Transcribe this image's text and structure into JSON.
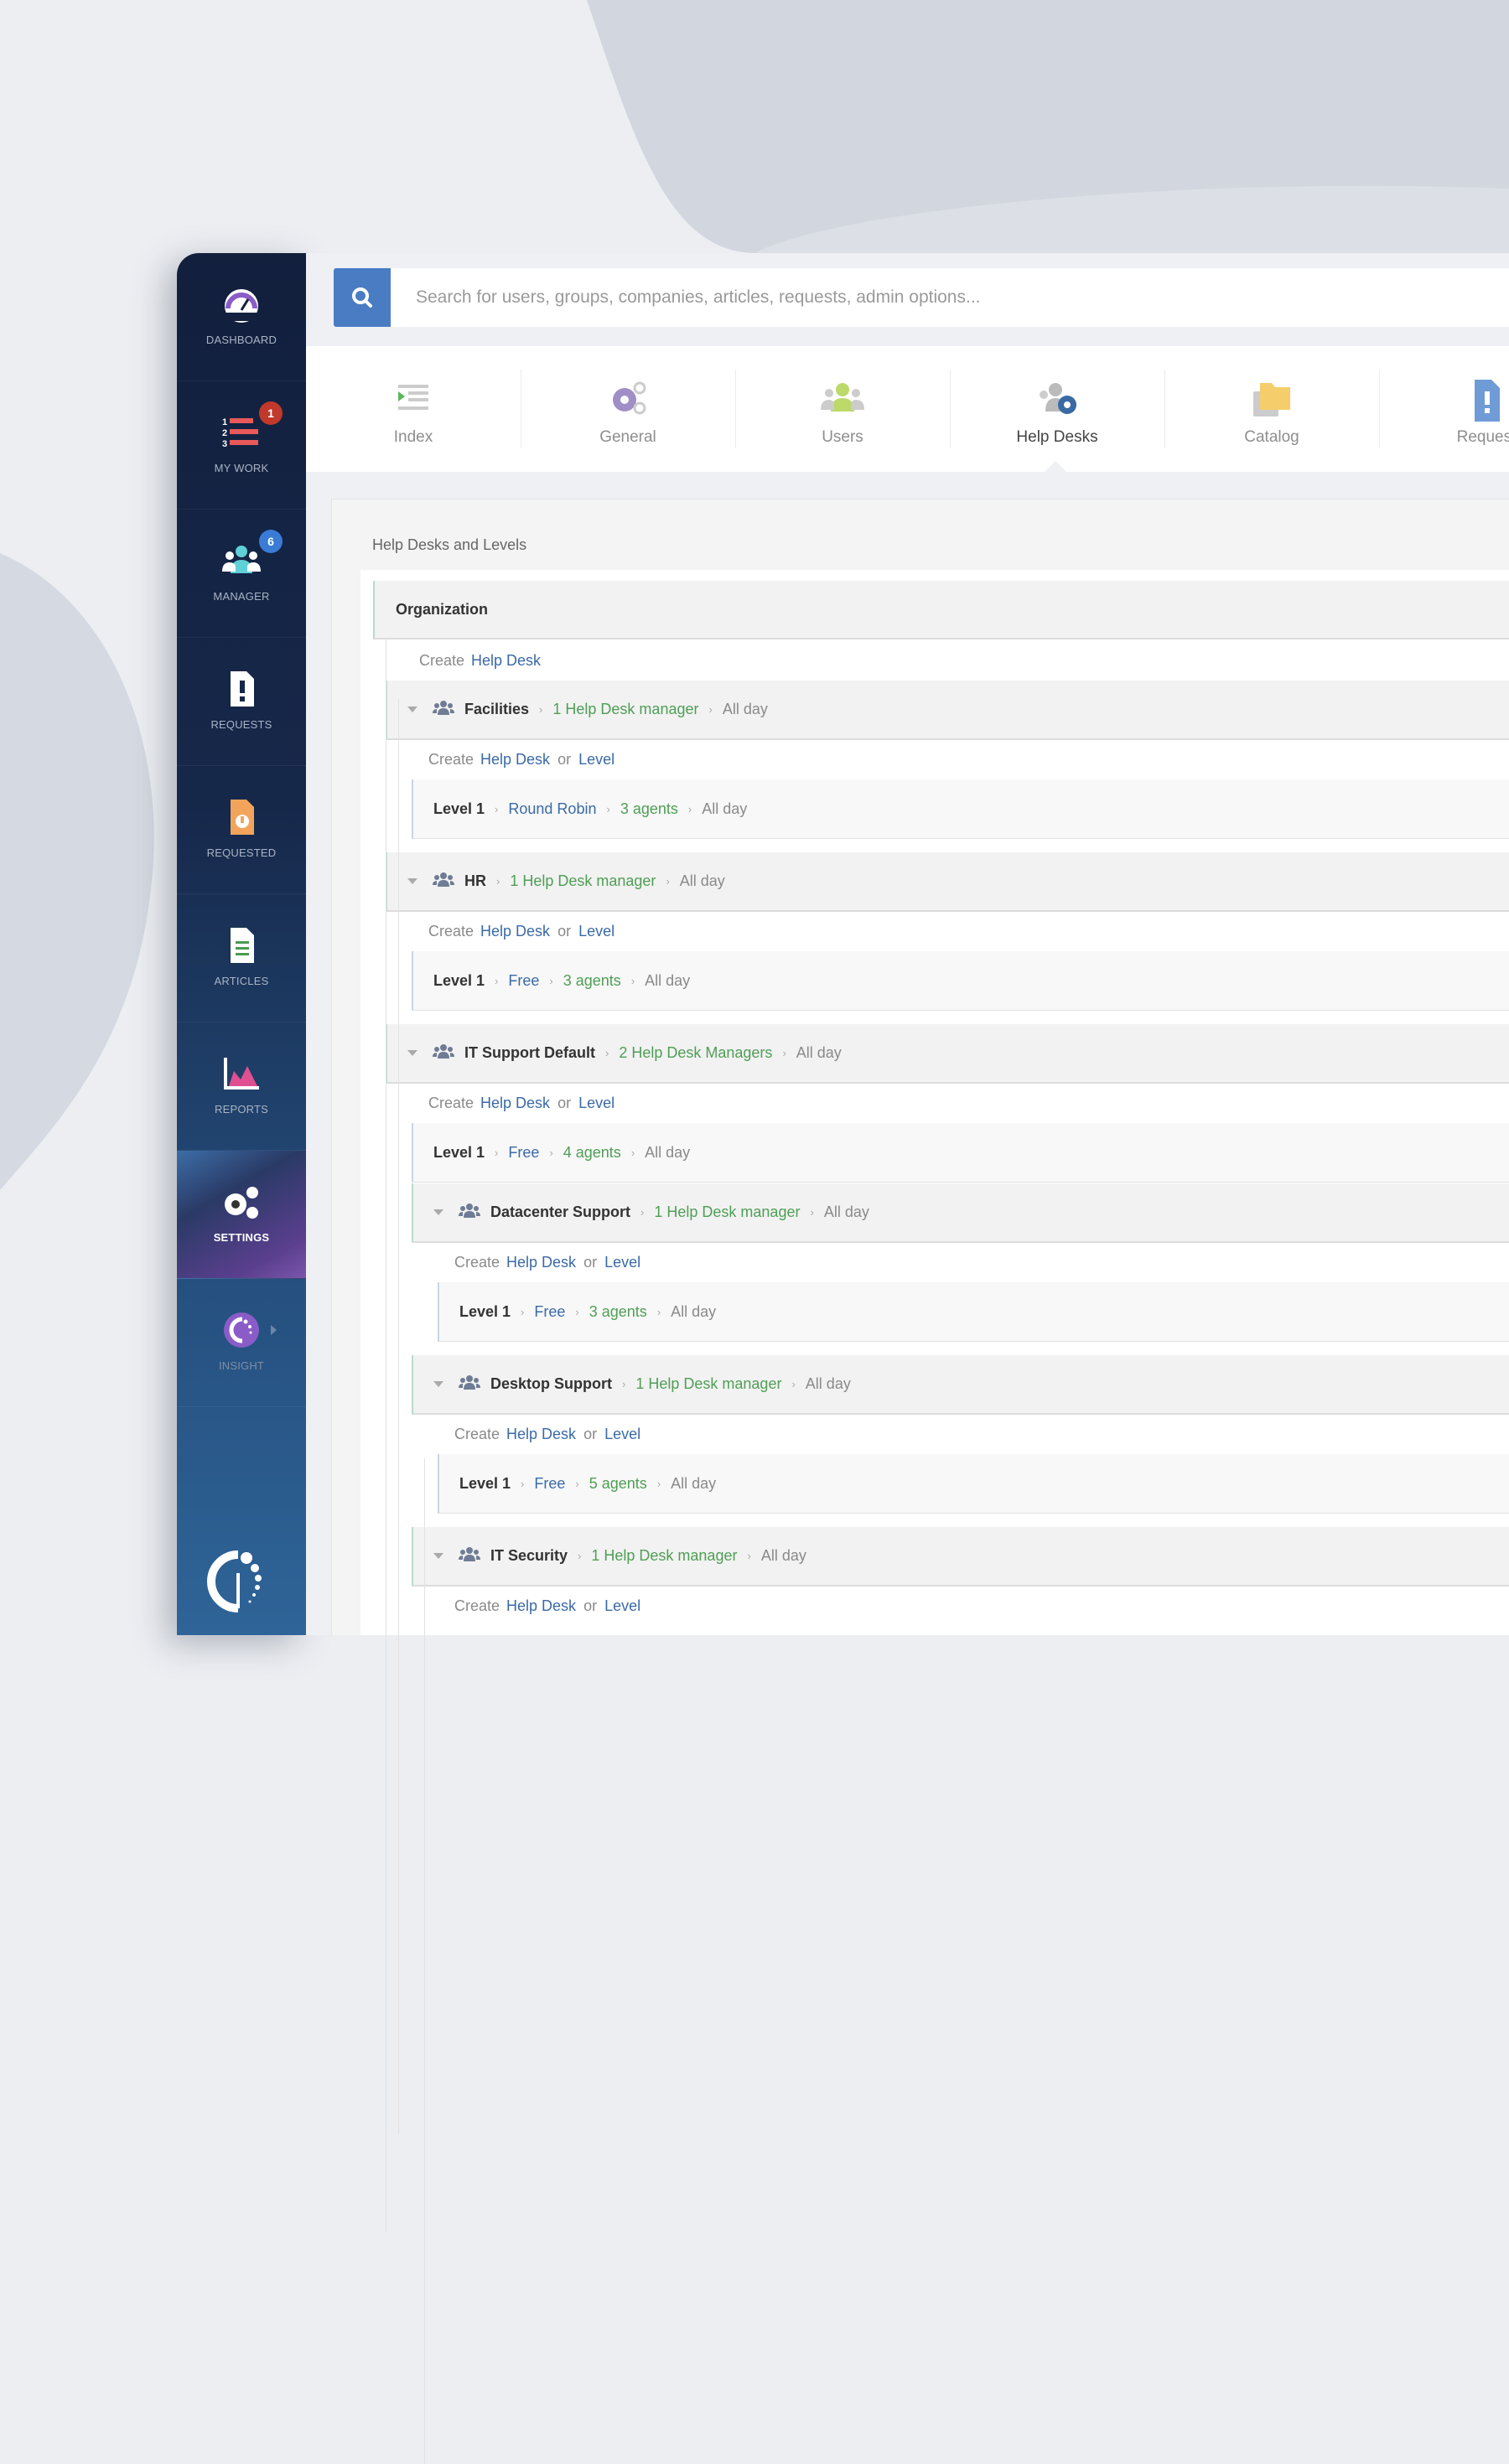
{
  "colors": {
    "sidebar_top": "#121f3d",
    "sidebar_bottom": "#2f6498",
    "search_button": "#4a7cc4",
    "link_blue": "#3a6aa6",
    "link_green": "#4f9e55",
    "badge_red": "#c0392b",
    "badge_blue": "#3a7bd5"
  },
  "sidebar": {
    "items": [
      {
        "label": "DASHBOARD",
        "icon": "dashboard-gauge-icon"
      },
      {
        "label": "MY WORK",
        "icon": "numbered-list-icon",
        "badge": "1"
      },
      {
        "label": "MANAGER",
        "icon": "team-icon",
        "badge": "6"
      },
      {
        "label": "REQUESTS",
        "icon": "request-document-icon"
      },
      {
        "label": "REQUESTED",
        "icon": "requested-document-icon"
      },
      {
        "label": "ARTICLES",
        "icon": "article-document-icon"
      },
      {
        "label": "REPORTS",
        "icon": "chart-icon"
      },
      {
        "label": "SETTINGS",
        "icon": "gears-icon",
        "active": true
      },
      {
        "label": "INSIGHT",
        "icon": "insight-icon"
      }
    ]
  },
  "search": {
    "placeholder": "Search for users, groups, companies, articles, requests, admin options..."
  },
  "tabs": [
    {
      "label": "Index",
      "icon": "index-list-icon"
    },
    {
      "label": "General",
      "icon": "gears-icon"
    },
    {
      "label": "Users",
      "icon": "users-icon"
    },
    {
      "label": "Help Desks",
      "icon": "help-desk-gear-icon",
      "active": true
    },
    {
      "label": "Catalog",
      "icon": "folder-icon"
    },
    {
      "label": "Request",
      "icon": "request-document-icon"
    }
  ],
  "section_title": "Help Desks and Levels",
  "organization": "Organization",
  "create_word": "Create",
  "help_desk_link": "Help Desk",
  "or_word": "or",
  "level_link": "Level",
  "help_desks": [
    {
      "name": "Facilities",
      "managers": "1 Help Desk manager",
      "schedule": "All day",
      "depth": 1,
      "levels": [
        {
          "name": "Level 1",
          "mode": "Round Robin",
          "agents": "3 agents",
          "schedule": "All day"
        }
      ]
    },
    {
      "name": "HR",
      "managers": "1 Help Desk manager",
      "schedule": "All day",
      "depth": 1,
      "levels": [
        {
          "name": "Level 1",
          "mode": "Free",
          "agents": "3 agents",
          "schedule": "All day"
        }
      ]
    },
    {
      "name": "IT Support Default",
      "managers": "2 Help Desk Managers",
      "schedule": "All day",
      "depth": 1,
      "levels": [
        {
          "name": "Level 1",
          "mode": "Free",
          "agents": "4 agents",
          "schedule": "All day"
        }
      ]
    },
    {
      "name": "Datacenter Support",
      "managers": "1 Help Desk manager",
      "schedule": "All day",
      "depth": 2,
      "levels": [
        {
          "name": "Level 1",
          "mode": "Free",
          "agents": "3 agents",
          "schedule": "All day"
        }
      ]
    },
    {
      "name": "Desktop Support",
      "managers": "1 Help Desk manager",
      "schedule": "All day",
      "depth": 2,
      "levels": [
        {
          "name": "Level 1",
          "mode": "Free",
          "agents": "5 agents",
          "schedule": "All day"
        }
      ]
    },
    {
      "name": "IT Security",
      "managers": "1 Help Desk manager",
      "schedule": "All day",
      "depth": 2,
      "levels": []
    }
  ]
}
